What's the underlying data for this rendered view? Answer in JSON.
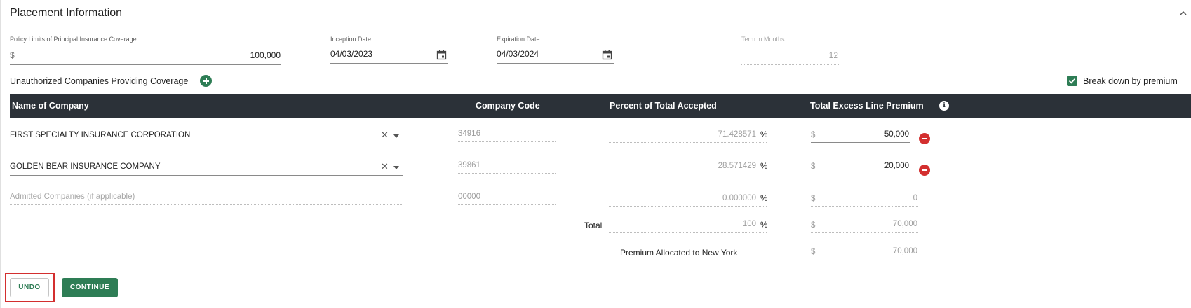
{
  "section": {
    "title": "Placement Information"
  },
  "policy": {
    "limits_label": "Policy Limits of Principal Insurance Coverage",
    "limits_currency": "$",
    "limits_value": "100,000",
    "inception_label": "Inception Date",
    "inception_value": "04/03/2023",
    "expiration_label": "Expiration Date",
    "expiration_value": "04/03/2024",
    "term_label": "Term in Months",
    "term_value": "12"
  },
  "unauthorized": {
    "label": "Unauthorized Companies Providing Coverage",
    "breakdown_label": "Break down by premium",
    "breakdown_checked": true
  },
  "table": {
    "columns": [
      "Name of Company",
      "Company Code",
      "Percent of Total Accepted",
      "Total Excess Line Premium"
    ],
    "rows": [
      {
        "name": "FIRST SPECIALTY INSURANCE CORPORATION",
        "code": "34916",
        "percent": "71.428571",
        "pct_sign": "%",
        "currency": "$",
        "premium": "50,000"
      },
      {
        "name": "GOLDEN BEAR INSURANCE COMPANY",
        "code": "39861",
        "percent": "28.571429",
        "pct_sign": "%",
        "currency": "$",
        "premium": "20,000"
      }
    ],
    "admitted": {
      "placeholder": "Admitted Companies (if applicable)",
      "code": "00000",
      "percent": "0.000000",
      "pct_sign": "%",
      "currency": "$",
      "premium": "0"
    },
    "total": {
      "label": "Total",
      "percent": "100",
      "pct_sign": "%",
      "currency": "$",
      "premium": "70,000"
    },
    "allocated": {
      "label": "Premium Allocated to New York",
      "currency": "$",
      "premium": "70,000"
    }
  },
  "buttons": {
    "undo": "UNDO",
    "continue": "CONTINUE"
  },
  "colors": {
    "accent": "#2e7d55",
    "header_bg": "#2b3138",
    "remove": "#d32f2f",
    "highlight": "#d32f2f"
  },
  "icons": {
    "collapse": "chevron-up-icon",
    "calendar": "calendar-icon",
    "add": "plus-circle-icon",
    "remove": "minus-circle-icon",
    "info": "info-icon",
    "clear": "close-icon",
    "dropdown": "caret-down-icon",
    "checkbox": "check-icon"
  }
}
